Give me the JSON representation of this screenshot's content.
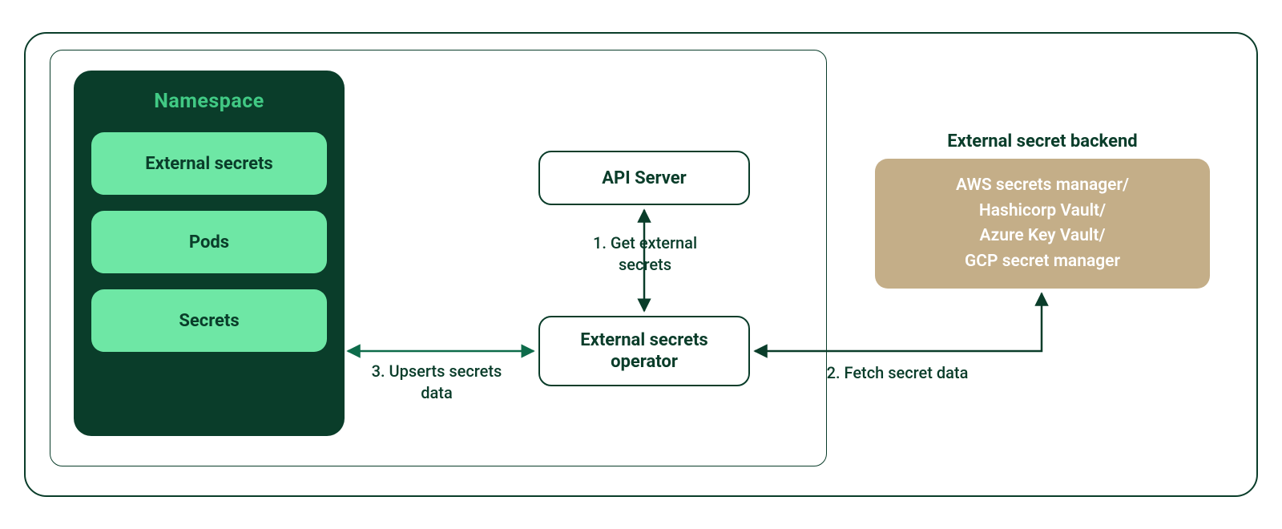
{
  "namespace": {
    "title": "Namespace",
    "items": [
      "External secrets",
      "Pods",
      "Secrets"
    ]
  },
  "api_server": {
    "label": "API Server"
  },
  "operator": {
    "label": "External secrets operator"
  },
  "backend": {
    "title": "External secret backend",
    "lines": [
      "AWS secrets manager/",
      "Hashicorp Vault/",
      "Azure Key Vault/",
      "GCP secret manager"
    ]
  },
  "edges": {
    "one": "1. Get external secrets",
    "two": "2. Fetch secret data",
    "three": "3. Upserts secrets data"
  },
  "colors": {
    "dark_green": "#0a3d2a",
    "bright_green": "#41c984",
    "light_green": "#6ee7a5",
    "arrow_green": "#0d6b4a",
    "tan": "#c4ae88"
  }
}
